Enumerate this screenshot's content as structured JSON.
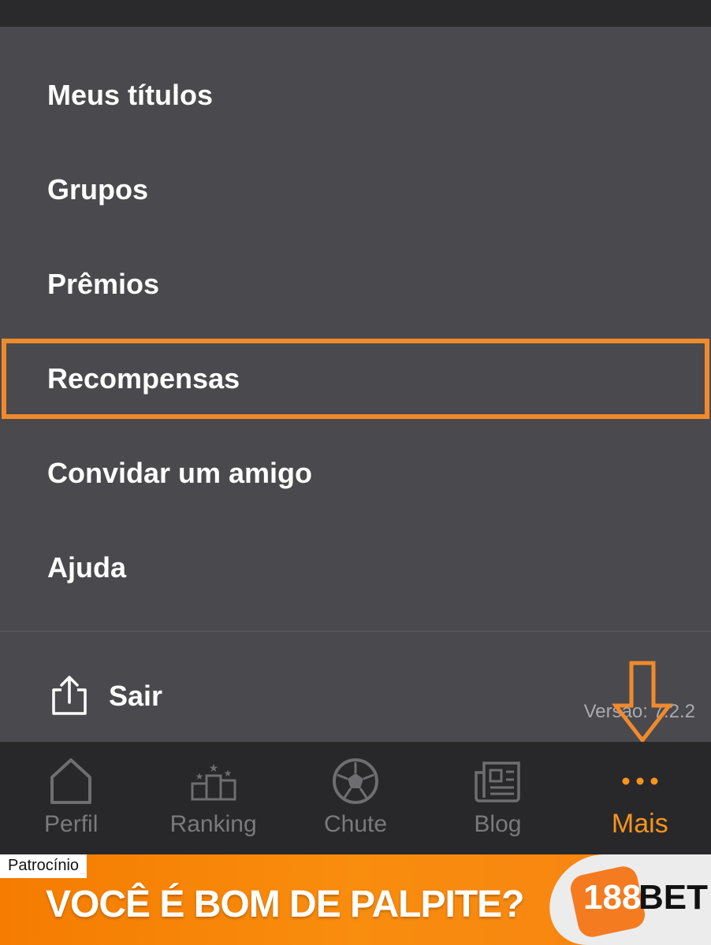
{
  "menu": {
    "items": [
      {
        "label": "Meus títulos"
      },
      {
        "label": "Grupos"
      },
      {
        "label": "Prêmios"
      },
      {
        "label": "Recompensas"
      },
      {
        "label": "Convidar um amigo"
      },
      {
        "label": "Ajuda"
      }
    ],
    "logout_label": "Sair",
    "version": "Versão: 7.2.2"
  },
  "tabbar": {
    "tabs": [
      {
        "label": "Perfil",
        "icon": "home-icon"
      },
      {
        "label": "Ranking",
        "icon": "podium-icon"
      },
      {
        "label": "Chute",
        "icon": "soccer-ball-icon"
      },
      {
        "label": "Blog",
        "icon": "newspaper-icon"
      },
      {
        "label": "Mais",
        "icon": "more-dots-icon",
        "active": true
      }
    ]
  },
  "banner": {
    "sponsor_tag": "Patrocínio",
    "headline": "VOCÊ É BOM DE PALPITE?",
    "logo_number": "188",
    "logo_word": "BET"
  },
  "colors": {
    "accent": "#f7941d",
    "highlight": "#f08a2c",
    "menu_bg": "#49494e",
    "tabbar_bg": "#28282a"
  }
}
